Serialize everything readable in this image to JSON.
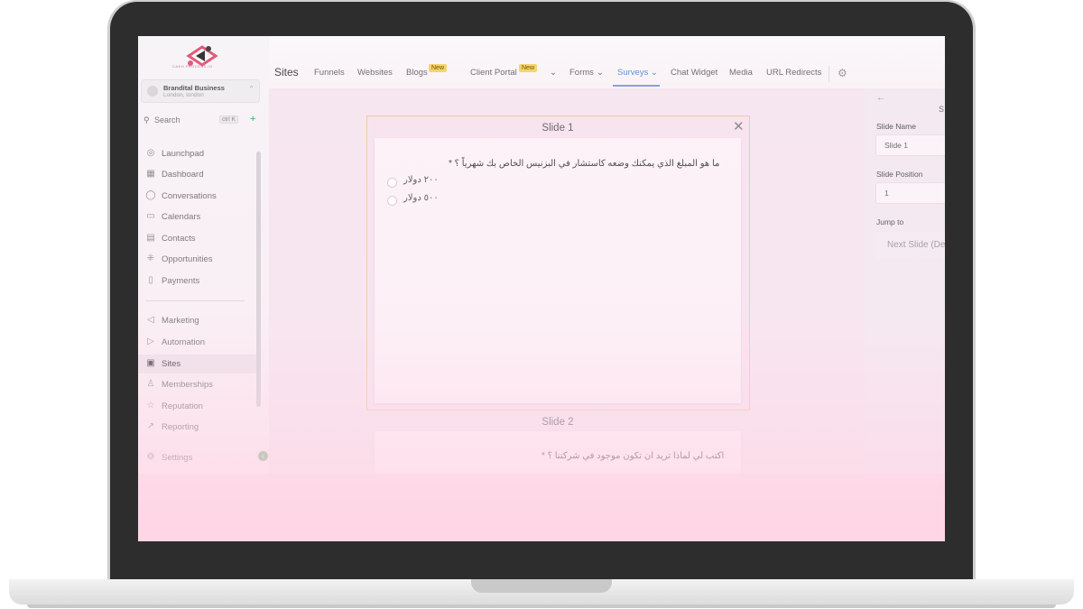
{
  "sidebar": {
    "logo_text": "CASH PROCESS.IO",
    "account": {
      "name": "Brandital Business",
      "location": "London, london"
    },
    "search": {
      "label": "Search",
      "shortcut": "ctrl K"
    },
    "items": [
      {
        "label": "Launchpad"
      },
      {
        "label": "Dashboard"
      },
      {
        "label": "Conversations"
      },
      {
        "label": "Calendars"
      },
      {
        "label": "Contacts"
      },
      {
        "label": "Opportunities"
      },
      {
        "label": "Payments"
      },
      {
        "label": "Marketing"
      },
      {
        "label": "Automation"
      },
      {
        "label": "Sites"
      },
      {
        "label": "Memberships"
      },
      {
        "label": "Reputation"
      },
      {
        "label": "Reporting"
      },
      {
        "label": "Settings"
      }
    ]
  },
  "topnav": {
    "section": "Sites",
    "tabs": [
      {
        "label": "Funnels"
      },
      {
        "label": "Websites"
      },
      {
        "label": "Blogs",
        "badge": "New"
      },
      {
        "label": "Client Portal",
        "badge": "New"
      },
      {
        "label": "Forms"
      },
      {
        "label": "Surveys"
      },
      {
        "label": "Chat Widget"
      },
      {
        "label": "Media"
      },
      {
        "label": "URL Redirects"
      }
    ]
  },
  "slides": [
    {
      "title": "Slide 1",
      "question": "ما هو المبلغ الذي يمكنك وضعه كاستشار في البزنيس الخاص بك شهرياً ؟ *",
      "options": [
        "٢٠٠ دولار",
        "٥٠٠ دولار"
      ]
    },
    {
      "title": "Slide 2",
      "question": "اكتب لي لماذا تريد ان تكون موجود في شركتنا ؟ *"
    }
  ],
  "right_panel": {
    "heading": "S",
    "slide_name_label": "Slide Name",
    "slide_name_value": "Slide 1",
    "slide_position_label": "Slide Position",
    "slide_position_value": "1",
    "jump_to_label": "Jump to",
    "jump_to_value": "Next Slide (De"
  },
  "colors": {
    "accent": "#5b8fd6",
    "badge": "#f5d56a",
    "add": "#33a853",
    "frame_highlight": "#f2c9a3"
  }
}
